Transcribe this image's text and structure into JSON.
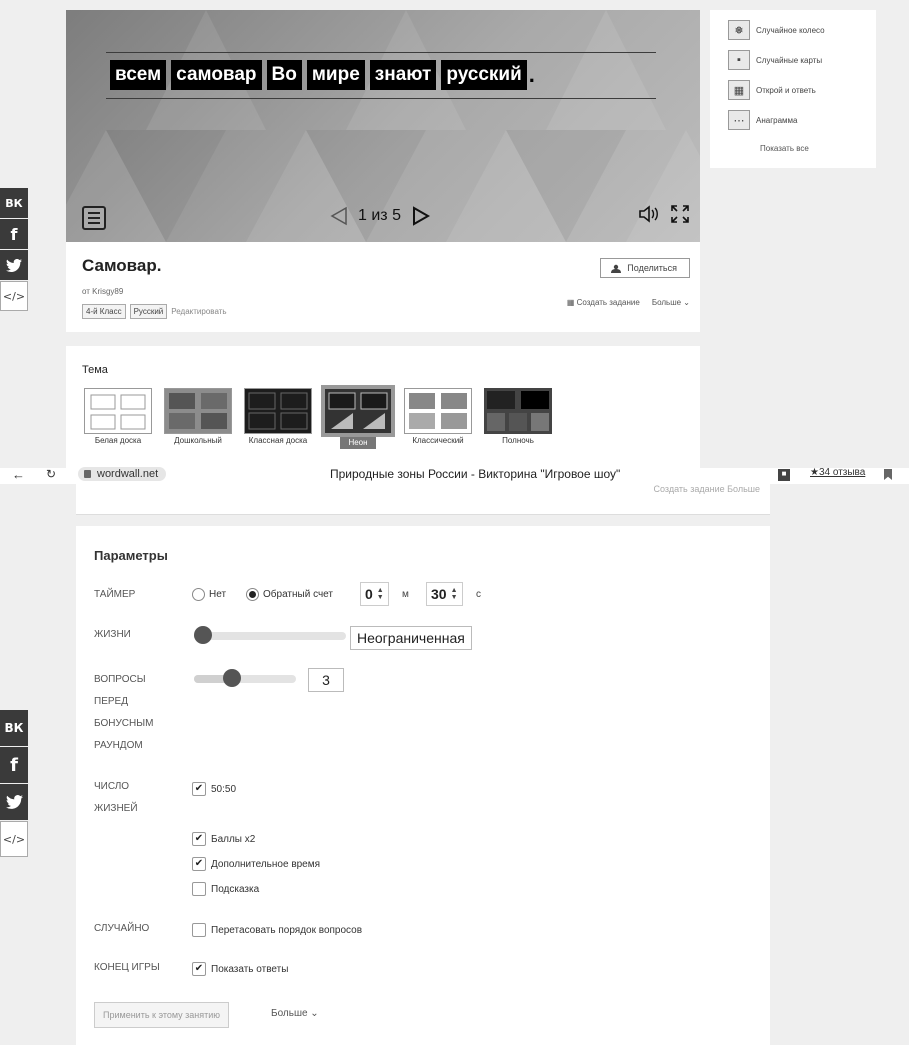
{
  "top_social": {
    "vk": "ВК",
    "fb": "f",
    "tw": "t",
    "embed": "</>"
  },
  "stage": {
    "words": [
      "всем",
      "самовар",
      "Во",
      "мире",
      "знают",
      "русский"
    ],
    "end_punct": ".",
    "counter": "1 из 5"
  },
  "activity": {
    "title": "Самовар.",
    "author": "от Krisgy89",
    "tags": [
      "4-й Класс",
      "Русский"
    ],
    "edit_link": "Редактировать",
    "share_label": "Поделиться",
    "create_task": "Создать задание",
    "more": "Больше ⌄"
  },
  "theme_section": {
    "title": "Тема",
    "themes": [
      {
        "name": "Белая доска",
        "selected": false
      },
      {
        "name": "Дошкольный",
        "selected": false
      },
      {
        "name": "Классная доска",
        "selected": false
      },
      {
        "name": "Неон",
        "selected": true
      },
      {
        "name": "Классический",
        "selected": false
      },
      {
        "name": "Полночь",
        "selected": false
      }
    ]
  },
  "side_panel": {
    "items": [
      "Случайное колесо",
      "Случайные карты",
      "Открой и ответь",
      "Анаграмма"
    ],
    "more": "Показать все"
  },
  "browser": {
    "url": "wordwall.net",
    "page_title": "Природные зоны России - Викторина \"Игровое шоу\"",
    "reviews": "★34 отзыва"
  },
  "bottom_strip": {
    "ghost": "Создать задание   Больше"
  },
  "params": {
    "title": "Параметры",
    "timer_label": "ТАЙМЕР",
    "timer_none": "Нет",
    "timer_countdown": "Обратный счет",
    "minutes": "0",
    "minutes_unit": "м",
    "seconds": "30",
    "seconds_unit": "с",
    "lives_label": "ЖИЗНИ",
    "lives_value": "Неограниченная",
    "lives_level": 0,
    "bonus_label_lines": [
      "ВОПРОСЫ",
      "ПЕРЕД",
      "БОНУСНЫМ",
      "РАУНДОМ"
    ],
    "bonus_value": "3",
    "bonus_level": 0.35,
    "powerups_label_lines": [
      "ЧИСЛО",
      "ЖИЗНЕЙ"
    ],
    "powerups": [
      {
        "label": "50:50",
        "checked": true
      },
      {
        "label": "Баллы x2",
        "checked": true
      },
      {
        "label": "Дополнительное время",
        "checked": true
      },
      {
        "label": "Подсказка",
        "checked": false
      }
    ],
    "random_label": "СЛУЧАЙНО",
    "shuffle_label": "Перетасовать порядок вопросов",
    "end_label": "КОНЕЦ ИГРЫ",
    "show_answers_label": "Показать ответы",
    "apply_button": "Применить к этому занятию",
    "more_button": "Больше ⌄"
  }
}
